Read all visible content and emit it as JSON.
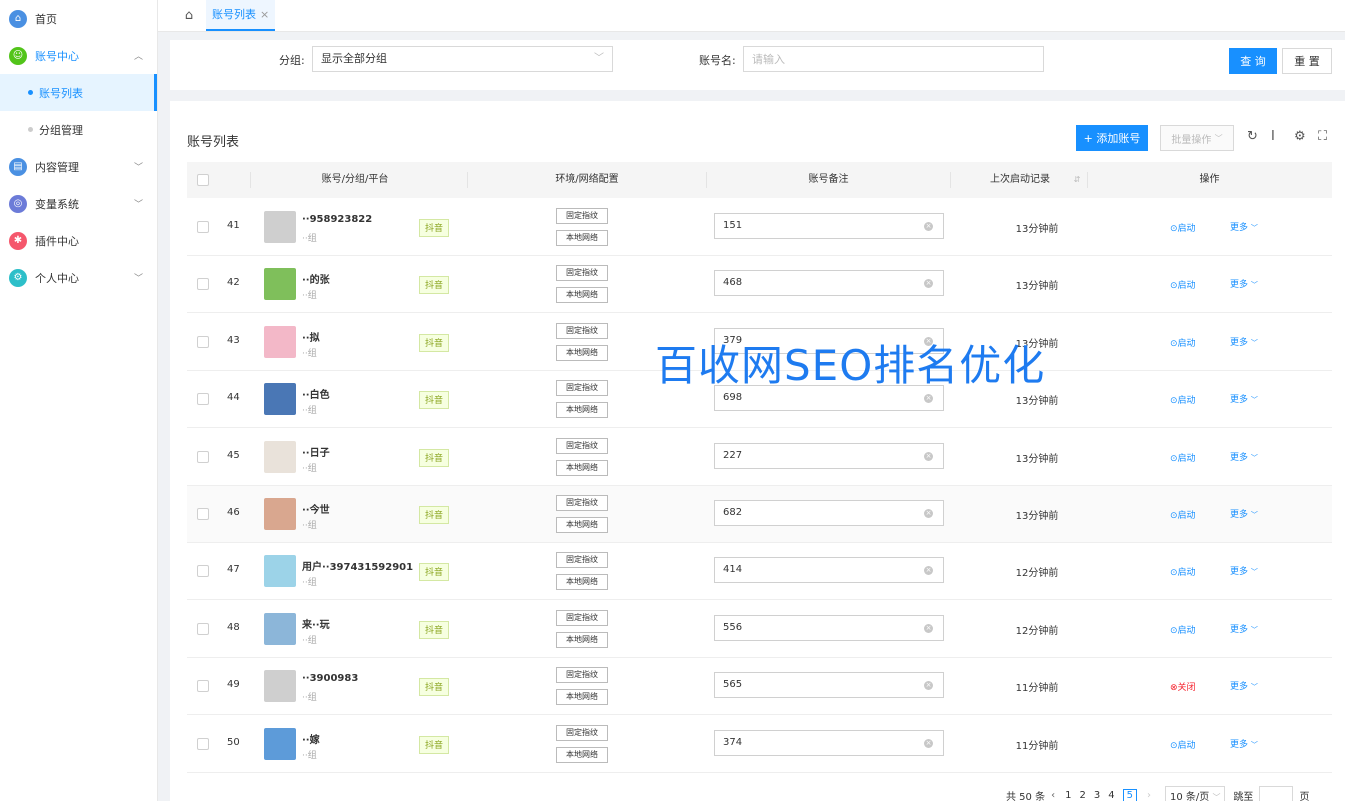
{
  "sidebar": {
    "items": [
      {
        "label": "首页",
        "icon": "home-icon",
        "color": "#4a90e2"
      },
      {
        "label": "账号中心",
        "icon": "user-icon",
        "color": "#52c41a",
        "children": [
          {
            "label": "账号列表"
          },
          {
            "label": "分组管理"
          }
        ]
      },
      {
        "label": "内容管理",
        "icon": "document-icon",
        "color": "#4a90e2"
      },
      {
        "label": "变量系统",
        "icon": "variable-icon",
        "color": "#6c7bd8"
      },
      {
        "label": "插件中心",
        "icon": "plugin-icon",
        "color": "#f5576c"
      },
      {
        "label": "个人中心",
        "icon": "settings-icon",
        "color": "#2dbfc9"
      }
    ]
  },
  "tabs": [
    {
      "label": "账号列表"
    }
  ],
  "filter": {
    "group_label": "分组:",
    "group_value": "显示全部分组",
    "account_label": "账号名:",
    "account_placeholder": "请输入",
    "query_label": "查 询",
    "reset_label": "重 置"
  },
  "panel": {
    "title": "账号列表",
    "add_label": "+ 添加账号",
    "batch_label": "批量操作"
  },
  "table": {
    "headers": [
      "账号/分组/平台",
      "环境/网络配置",
      "账号备注",
      "上次启动记录",
      "操作"
    ],
    "env_tags": [
      "固定指纹",
      "本地网络"
    ],
    "platform_tag": "抖音",
    "more_label": "更多",
    "rows": [
      {
        "idx": "41",
        "name": "··958923822",
        "group": "··组",
        "remark": "151",
        "last": "13分钟前",
        "op": "启动",
        "avatar": "#cfcfcf"
      },
      {
        "idx": "42",
        "name": "··的张",
        "group": "··组",
        "remark": "468",
        "last": "13分钟前",
        "op": "启动",
        "avatar": "#7fbf5b"
      },
      {
        "idx": "43",
        "name": "··拟",
        "group": "··组",
        "remark": "379",
        "last": "13分钟前",
        "op": "启动",
        "avatar": "#f3b8c8"
      },
      {
        "idx": "44",
        "name": "··白色",
        "group": "··组",
        "remark": "698",
        "last": "13分钟前",
        "op": "启动",
        "avatar": "#4a77b5"
      },
      {
        "idx": "45",
        "name": "··日子",
        "group": "··组",
        "remark": "227",
        "last": "13分钟前",
        "op": "启动",
        "avatar": "#e9e2da"
      },
      {
        "idx": "46",
        "name": "··今世",
        "group": "··组",
        "remark": "682",
        "last": "13分钟前",
        "op": "启动",
        "avatar": "#d9a78f"
      },
      {
        "idx": "47",
        "name": "用户··397431592901",
        "group": "··组",
        "remark": "414",
        "last": "12分钟前",
        "op": "启动",
        "avatar": "#9cd3e8"
      },
      {
        "idx": "48",
        "name": "来··玩",
        "group": "··组",
        "remark": "556",
        "last": "12分钟前",
        "op": "启动",
        "avatar": "#8cb6d9"
      },
      {
        "idx": "49",
        "name": "··3900983",
        "group": "··组",
        "remark": "565",
        "last": "11分钟前",
        "op": "关闭",
        "avatar": "#cfcfcf"
      },
      {
        "idx": "50",
        "name": "··嫁",
        "group": "··组",
        "remark": "374",
        "last": "11分钟前",
        "op": "启动",
        "avatar": "#5d9bd9"
      }
    ]
  },
  "pagination": {
    "total": "共 50 条",
    "pages": [
      "1",
      "2",
      "3",
      "4",
      "5"
    ],
    "current": "5",
    "page_size": "10 条/页",
    "jump_label": "跳至",
    "page_suffix": "页"
  },
  "watermark": "百收网SEO排名优化"
}
